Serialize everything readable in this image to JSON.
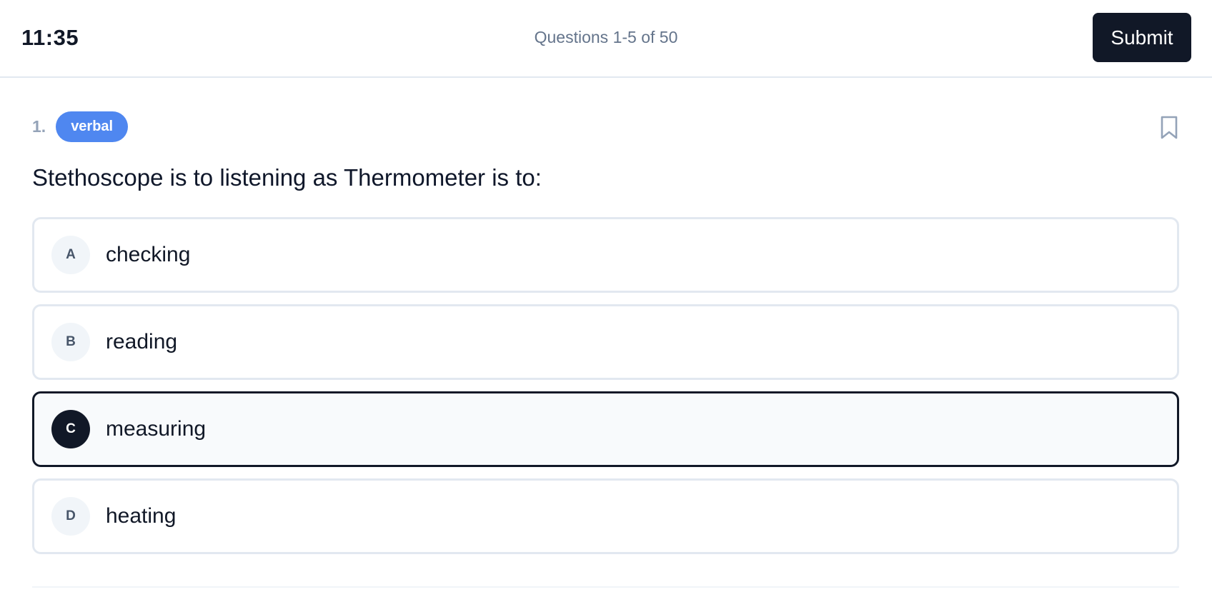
{
  "header": {
    "timer": "11:35",
    "progress": "Questions 1-5 of 50",
    "submit_label": "Submit"
  },
  "question": {
    "number": "1.",
    "category": "verbal",
    "text": "Stethoscope is to listening as Thermometer is to:",
    "bookmark_icon": "bookmark-icon",
    "options": [
      {
        "letter": "A",
        "text": "checking",
        "selected": false
      },
      {
        "letter": "B",
        "text": "reading",
        "selected": false
      },
      {
        "letter": "C",
        "text": "measuring",
        "selected": true
      },
      {
        "letter": "D",
        "text": "heating",
        "selected": false
      }
    ]
  },
  "colors": {
    "dark": "#111827",
    "badge": "#4f87f0",
    "border": "#e2e8f0",
    "muted": "#64748b"
  }
}
